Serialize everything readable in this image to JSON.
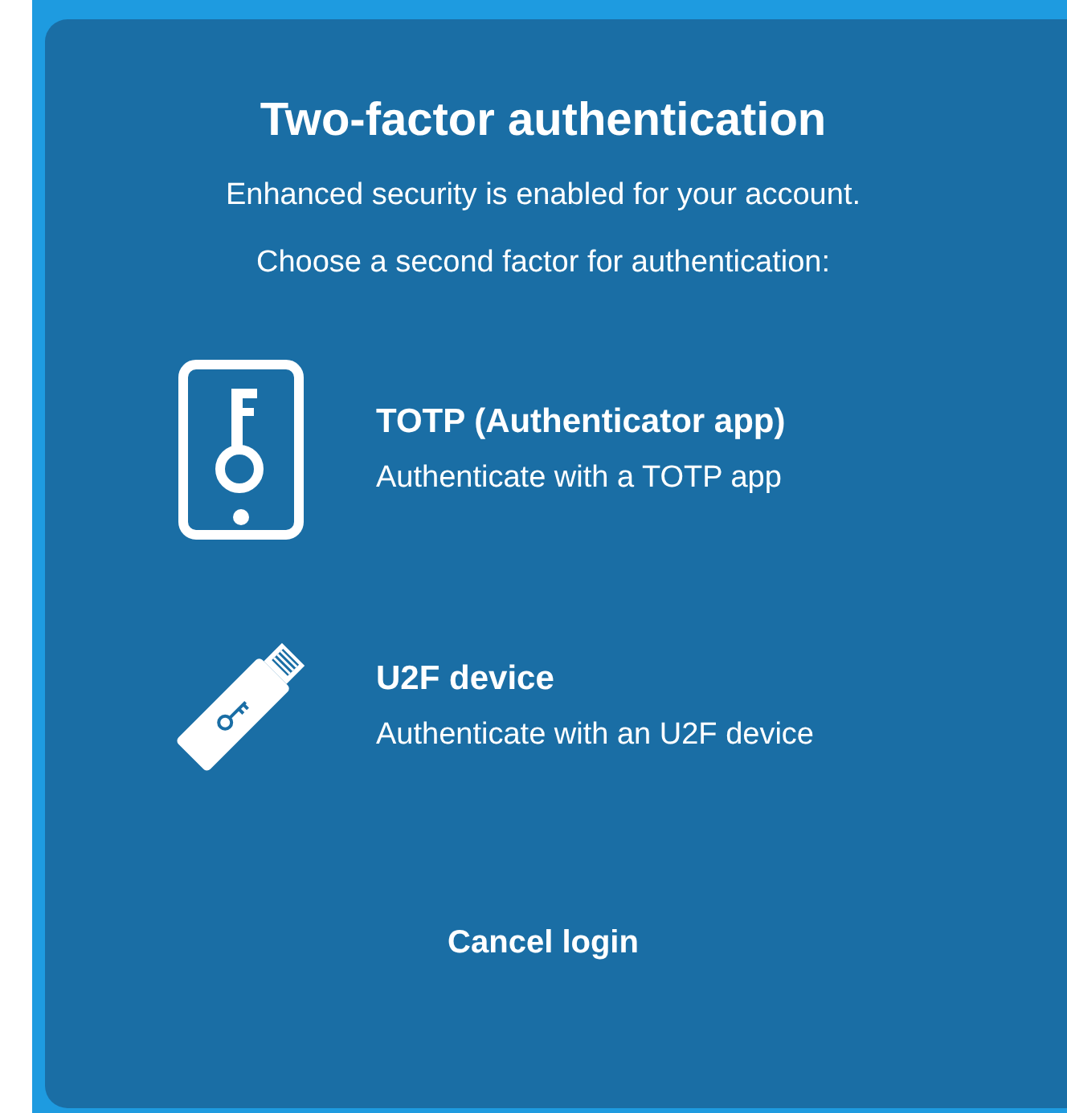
{
  "title": "Two-factor authentication",
  "intro": [
    "Enhanced security is enabled for your account.",
    "Choose a second factor for authentication:"
  ],
  "options": [
    {
      "kind": "totp",
      "title": "TOTP (Authenticator app)",
      "description": "Authenticate with a TOTP app"
    },
    {
      "kind": "u2f",
      "title": "U2F device",
      "description": "Authenticate with an U2F device"
    }
  ],
  "cancel": "Cancel login"
}
